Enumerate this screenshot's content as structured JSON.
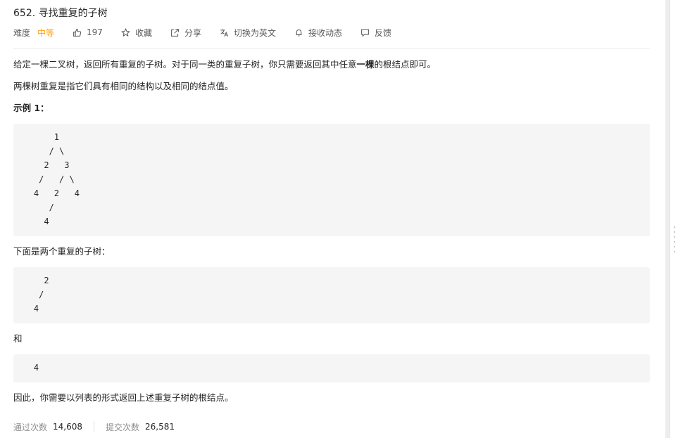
{
  "problem": {
    "title": "652. 寻找重复的子树",
    "difficulty_label": "难度",
    "difficulty": "中等",
    "likes": "197",
    "favorite_label": "收藏",
    "share_label": "分享",
    "translate_label": "切换为英文",
    "notify_label": "接收动态",
    "feedback_label": "反馈"
  },
  "description": {
    "para1_before": "给定一棵二叉树，返回所有重复的子树。对于同一类的重复子树，你只需要返回其中任意",
    "para1_bold": "一棵",
    "para1_after": "的根结点即可。",
    "para2": "两棵树重复是指它们具有相同的结构以及相同的结点值。",
    "example_title": "示例 1：",
    "tree_example": "        1\n       / \\\n      2   3\n     /   / \\\n    4   2   4\n       /\n      4",
    "para3": "下面是两个重复的子树：",
    "dup_tree_1": "      2\n     /\n    4",
    "para4": "和",
    "dup_tree_2": "    4",
    "para5": "因此，你需要以列表的形式返回上述重复子树的根结点。"
  },
  "stats": {
    "accepted_label": "通过次数",
    "accepted": "14,608",
    "submissions_label": "提交次数",
    "submissions": "26,581"
  },
  "icons": {
    "like": "thumbs-up-icon",
    "favorite": "star-icon",
    "share": "share-icon",
    "translate": "translate-icon",
    "notify": "bell-icon",
    "feedback": "feedback-icon"
  },
  "colors": {
    "difficulty_medium": "#ffa116",
    "code_background": "#f5f5f5"
  }
}
